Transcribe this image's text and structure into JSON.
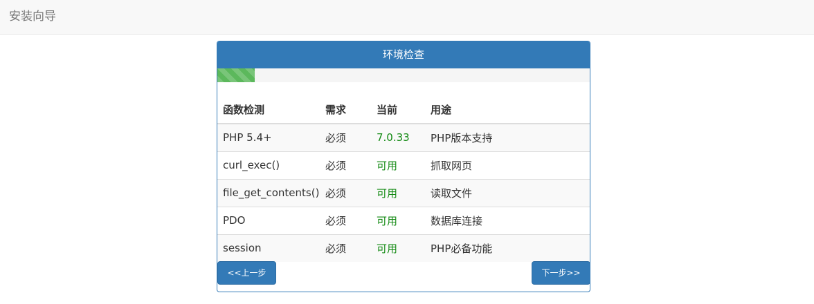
{
  "navbar": {
    "brand": "安装向导"
  },
  "panel": {
    "title": "环境检查",
    "progress_percent": 10
  },
  "table": {
    "headers": [
      "函数检测",
      "需求",
      "当前",
      "用途"
    ],
    "rows": [
      [
        "PHP 5.4+",
        "必须",
        "7.0.33",
        "PHP版本支持"
      ],
      [
        "curl_exec()",
        "必须",
        "可用",
        "抓取网页"
      ],
      [
        "file_get_contents()",
        "必须",
        "可用",
        "读取文件"
      ],
      [
        "PDO",
        "必须",
        "可用",
        "数据库连接"
      ],
      [
        "session",
        "必须",
        "可用",
        "PHP必备功能"
      ]
    ]
  },
  "buttons": {
    "prev": "<<上一步",
    "next": "下一步>>"
  },
  "colors": {
    "primary": "#337ab7",
    "success": "#5cb85c",
    "ok_text": "#138a13"
  }
}
